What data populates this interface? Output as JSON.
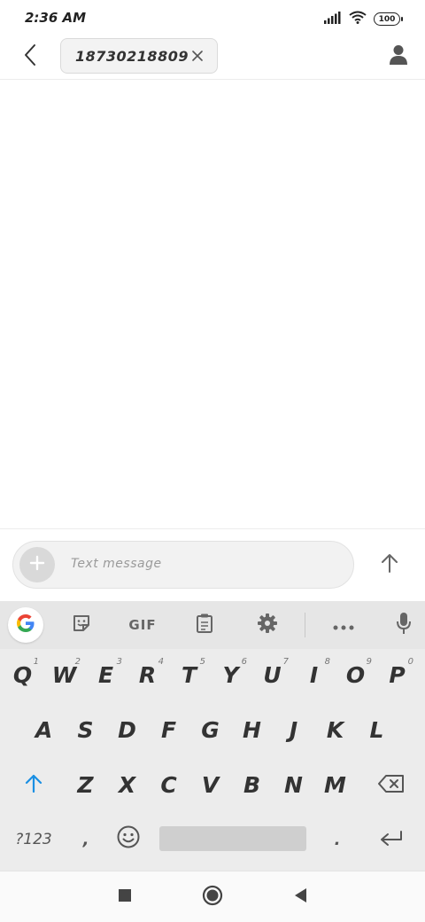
{
  "status_bar": {
    "time": "2:36 AM",
    "battery": "100",
    "icons": [
      "signal-icon",
      "wifi-icon",
      "battery-icon"
    ]
  },
  "header": {
    "back_icon": "chevron-left-icon",
    "recipient": "18730218809",
    "remove_icon": "close-icon",
    "contact_icon": "person-icon"
  },
  "compose": {
    "add_icon": "plus-icon",
    "placeholder": "Text message",
    "send_icon": "arrow-up-icon"
  },
  "keyboard": {
    "toolbar": {
      "google_icon": "google-g-icon",
      "sticker_icon": "sticker-icon",
      "gif_label": "GIF",
      "clipboard_icon": "clipboard-icon",
      "settings_icon": "gear-icon",
      "more_icon": "more-horizontal-icon",
      "mic_icon": "microphone-icon"
    },
    "row1": [
      {
        "label": "Q",
        "hint": "1"
      },
      {
        "label": "W",
        "hint": "2"
      },
      {
        "label": "E",
        "hint": "3"
      },
      {
        "label": "R",
        "hint": "4"
      },
      {
        "label": "T",
        "hint": "5"
      },
      {
        "label": "Y",
        "hint": "6"
      },
      {
        "label": "U",
        "hint": "7"
      },
      {
        "label": "I",
        "hint": "8"
      },
      {
        "label": "O",
        "hint": "9"
      },
      {
        "label": "P",
        "hint": "0"
      }
    ],
    "row2": [
      "A",
      "S",
      "D",
      "F",
      "G",
      "H",
      "J",
      "K",
      "L"
    ],
    "row3": [
      "Z",
      "X",
      "C",
      "V",
      "B",
      "N",
      "M"
    ],
    "shift_icon": "shift-arrow-icon",
    "backspace_icon": "backspace-icon",
    "symbols_label": "?123",
    "comma_label": ",",
    "emoji_icon": "emoji-icon",
    "period_label": ".",
    "enter_icon": "enter-icon"
  },
  "nav_bar": {
    "recents_icon": "square-icon",
    "home_icon": "circle-icon",
    "back_icon": "triangle-back-icon"
  },
  "colors": {
    "accent": "#1a8fe3",
    "keyboard_bg": "#ececec",
    "key_text": "#333333"
  }
}
